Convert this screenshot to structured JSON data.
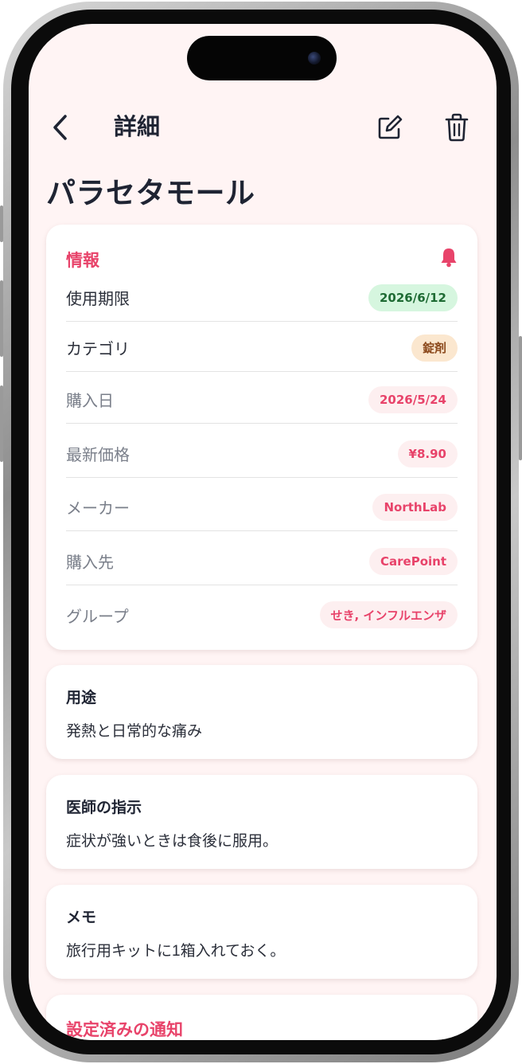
{
  "navbar": {
    "title": "詳細"
  },
  "medicine": {
    "name": "パラセタモール"
  },
  "info": {
    "heading": "情報",
    "rows": [
      {
        "label": "使用期限",
        "value": "2026/6/12"
      },
      {
        "label": "カテゴリ",
        "value": "錠剤"
      },
      {
        "label": "購入日",
        "value": "2026/5/24"
      },
      {
        "label": "最新価格",
        "value": "¥8.90"
      },
      {
        "label": "メーカー",
        "value": "NorthLab"
      },
      {
        "label": "購入先",
        "value": "CarePoint"
      },
      {
        "label": "グループ",
        "value": "せき, インフルエンザ"
      }
    ]
  },
  "usage": {
    "title": "用途",
    "body": "発熱と日常的な痛み"
  },
  "doctor": {
    "title": "医師の指示",
    "body": "症状が強いときは食後に服用。"
  },
  "memo": {
    "title": "メモ",
    "body": "旅行用キットに1箱入れておく。"
  },
  "notifications": {
    "heading": "設定済みの通知"
  },
  "colors": {
    "accent": "#e8436a",
    "background": "#fff4f4",
    "expiry_badge": "#d6f6df",
    "category_badge": "#fbe7cf"
  }
}
